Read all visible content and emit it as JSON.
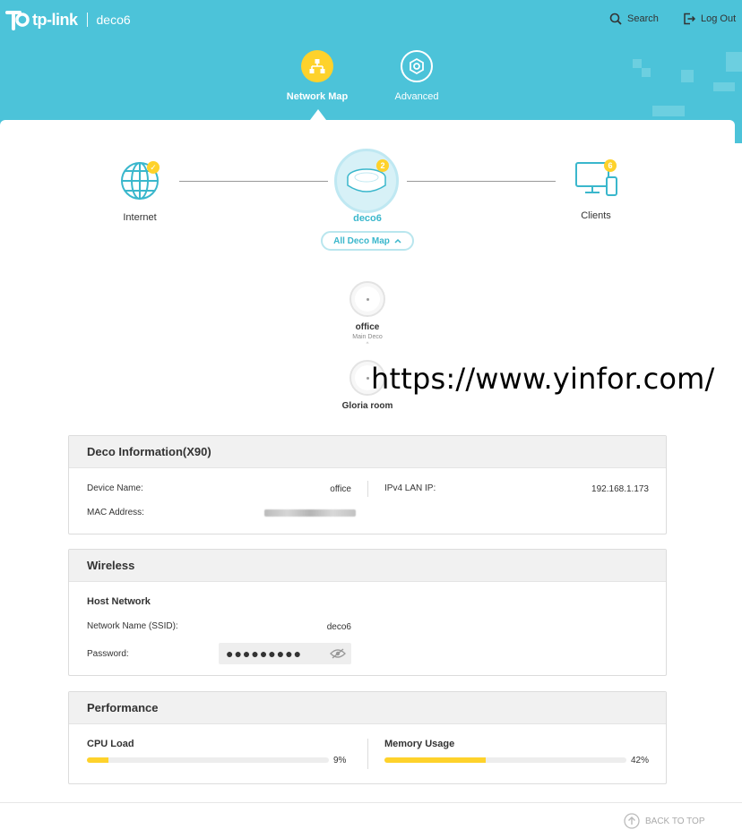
{
  "brand": {
    "name": "tp-link",
    "host": "deco6"
  },
  "top_actions": {
    "search": "Search",
    "logout": "Log Out"
  },
  "nav": {
    "network_map": "Network Map",
    "advanced": "Advanced"
  },
  "map": {
    "internet_label": "Internet",
    "deco_label": "deco6",
    "deco_badge": "2",
    "clients_label": "Clients",
    "clients_badge": "6",
    "all_deco_button": "All Deco Map"
  },
  "sub_decos": [
    {
      "name": "office",
      "role": "Main Deco"
    },
    {
      "name": "Gloria room",
      "role": ""
    }
  ],
  "watermark": "https://www.yinfor.com/",
  "deco_info": {
    "title": "Deco Information(X90)",
    "device_name_label": "Device Name:",
    "device_name_value": "office",
    "ipv4_label": "IPv4 LAN IP:",
    "ipv4_value": "192.168.1.173",
    "mac_label": "MAC Address:"
  },
  "wireless": {
    "title": "Wireless",
    "host_network": "Host Network",
    "ssid_label": "Network Name (SSID):",
    "ssid_value": "deco6",
    "password_label": "Password:",
    "password_value": "●●●●●●●●●"
  },
  "performance": {
    "title": "Performance",
    "cpu_label": "CPU Load",
    "cpu_percent": 9,
    "cpu_text": "9%",
    "memory_label": "Memory Usage",
    "memory_percent": 42,
    "memory_text": "42%"
  },
  "footer": {
    "back_to_top": "BACK TO TOP"
  },
  "colors": {
    "header": "#4cc3d9",
    "accent": "#fed22b",
    "teal": "#3ab7cc"
  }
}
